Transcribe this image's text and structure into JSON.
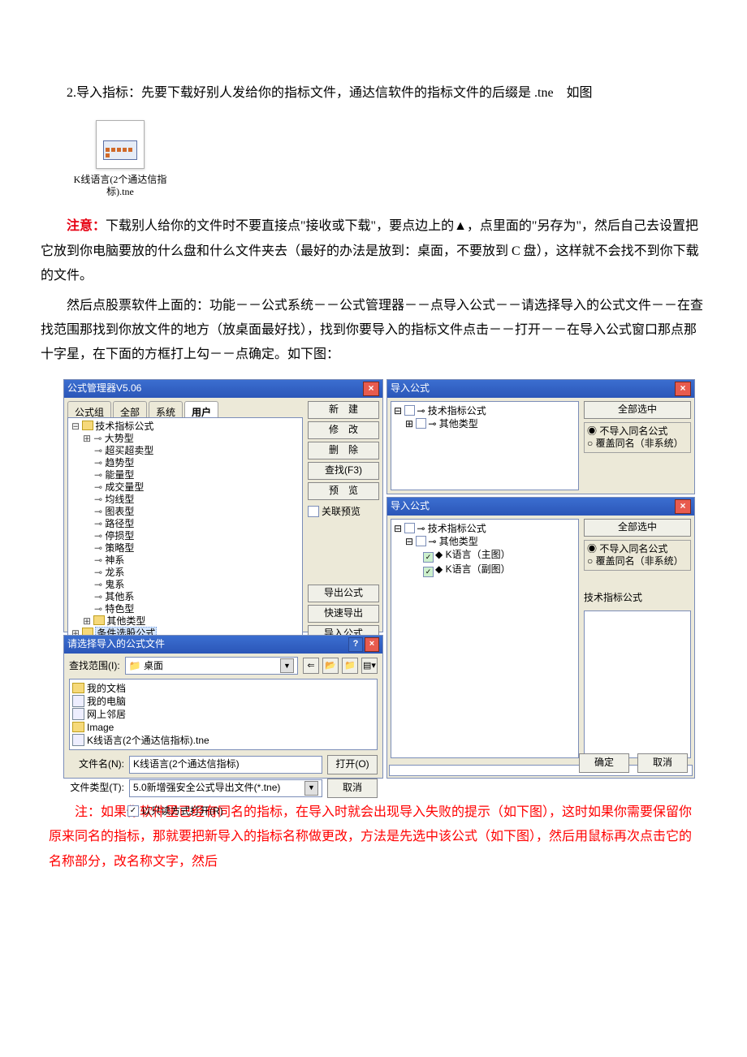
{
  "intro": {
    "p1": "2.导入指标：先要下载好别人发给你的指标文件，通达信软件的指标文件的后缀是 .tne　如图"
  },
  "file_icon": {
    "filename": "K线语言(2个通达信指标).tne"
  },
  "body": {
    "p_warn_lead": "注意：",
    "p_warn_rest": "下载别人给你的文件时不要直接点\"接收或下载\"，要点边上的▲，点里面的\"另存为\"，然后自己去设置把它放到你电脑要放的什么盘和什么文件夹去（最好的办法是放到：桌面，不要放到 C 盘），这样就不会找不到你下载的文件。",
    "p_steps": "然后点股票软件上面的：功能－－公式系统－－公式管理器－－点导入公式－－请选择导入的公式文件－－在查找范围那找到你放文件的地方（放桌面最好找），找到你要导入的指标文件点击－－打开－－在导入公式窗口那点那十字星，在下面的方框打上勾－－点确定。如下图："
  },
  "fm": {
    "title": "公式管理器V5.06",
    "tabs": [
      "公式组",
      "全部",
      "系统",
      "用户"
    ],
    "root1": "技术指标公式",
    "leaves": [
      "大势型",
      "超买超卖型",
      "趋势型",
      "能量型",
      "成交量型",
      "均线型",
      "图表型",
      "路径型",
      "停损型",
      "策略型",
      "神系",
      "龙系",
      "鬼系",
      "其他系",
      "特色型"
    ],
    "leaf_other": "其他类型",
    "root2": "条件选股公式",
    "btns": {
      "new": "新　建",
      "edit": "修　改",
      "del": "删　除",
      "find": "查找(F3)",
      "prev": "预　览",
      "assoc": "关联预览",
      "exp": "导出公式",
      "qexp": "快速导出",
      "imp": "导入公式"
    }
  },
  "imp1": {
    "title": "导入公式",
    "n1": "技术指标公式",
    "n2": "其他类型",
    "all": "全部选中",
    "r1": "不导入同名公式",
    "r2": "覆盖同名（非系统）"
  },
  "imp2": {
    "title": "导入公式",
    "n1": "技术指标公式",
    "n2": "其他类型",
    "i1": "K语言（主图）",
    "i2": "K语言（副图）",
    "all": "全部选中",
    "r1": "不导入同名公式",
    "r2": "覆盖同名（非系统）",
    "lbl": "技术指标公式",
    "ok": "确定",
    "cancel": "取消"
  },
  "fb": {
    "title": "请选择导入的公式文件",
    "range_l": "查找范围(I):",
    "range_v": "桌面",
    "items": [
      "我的文档",
      "我的电脑",
      "网上邻居",
      "Image",
      "K线语言(2个通达信指标).tne"
    ],
    "fn_l": "文件名(N):",
    "fn_v": "K线语言(2个通达信指标)",
    "ft_l": "文件类型(T):",
    "ft_v": "5.0新增强安全公式导出文件(*.tne)",
    "ro": "以只读方式打开(R)",
    "open": "打开(O)",
    "cancel": "取消"
  },
  "foot": {
    "lead": "注：",
    "p1": "如果你软件里已经有同名的指标，在导入时就会出现导入失败的提示（如下图），这时如果你需要保留你原来同名的指标，那就要把新导入的指标名称做更改，方法是先选中该公式（如下图），然后用鼠标再次点击它的名称部分，改名称文字，然后"
  }
}
